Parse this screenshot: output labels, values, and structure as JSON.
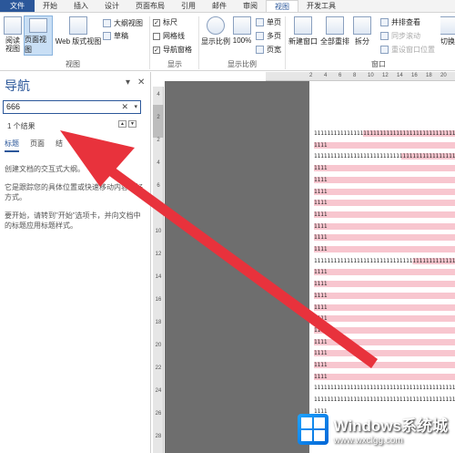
{
  "tabs": [
    "文件",
    "开始",
    "插入",
    "设计",
    "页面布局",
    "引用",
    "邮件",
    "审阅",
    "视图",
    "开发工具"
  ],
  "active_tab": "视图",
  "ribbon": {
    "views_group": {
      "label": "视图",
      "read_mode": "阅读\n视图",
      "print_layout": "页面视图",
      "web_layout": "Web 版式视图",
      "outline": "大纲视图",
      "draft": "草稿"
    },
    "show_group": {
      "label": "显示",
      "ruler": "标尺",
      "gridlines": "网格线",
      "nav_pane": "导航窗格",
      "ruler_checked": true,
      "gridlines_checked": false,
      "nav_pane_checked": true
    },
    "zoom_group": {
      "label": "显示比例",
      "zoom": "显示比例",
      "hundred": "100%",
      "one_page": "单页",
      "multi_page": "多页",
      "page_width": "页宽"
    },
    "window_group": {
      "label": "窗口",
      "new_window": "新建窗口",
      "arrange_all": "全部重排",
      "split": "拆分",
      "side_by_side": "并排查看",
      "sync_scroll": "同步滚动",
      "reset_position": "重设窗口位置",
      "switch": "切换"
    }
  },
  "nav": {
    "title": "导航",
    "search_value": "666",
    "results": "1 个结果",
    "tabs": [
      "标题",
      "页面",
      "结"
    ],
    "body": [
      "创建文档的交互式大纲。",
      "它是跟踪您的具体位置或快速移动内容的好方式。",
      "要开始，请转到\"开始\"选项卡，并向文档中的标题应用标题样式。"
    ]
  },
  "ruler": {
    "v_ticks": [
      "4",
      "2",
      "2",
      "4",
      "6",
      "8",
      "10",
      "12",
      "14",
      "16",
      "18",
      "20",
      "22",
      "24",
      "26",
      "28"
    ],
    "h_ticks": [
      "2",
      "4",
      "6",
      "8",
      "10",
      "12",
      "14",
      "16",
      "18",
      "20"
    ]
  },
  "document": {
    "lines": [
      {
        "text": "1111111111111111111111111111111111111111111111111111111111111",
        "hl": "partial"
      },
      {
        "text": "1111",
        "hl": true
      },
      {
        "text": "11111111111111111111111111111111111111111111111111111111111111",
        "hl": "partial2"
      },
      {
        "text": "1111",
        "hl": true
      },
      {
        "text": "1111",
        "hl": true
      },
      {
        "text": "1111",
        "hl": true
      },
      {
        "text": "1111",
        "hl": true
      },
      {
        "text": "1111",
        "hl": true
      },
      {
        "text": "1111",
        "hl": true
      },
      {
        "text": "1111",
        "hl": true
      },
      {
        "text": "1111",
        "hl": true
      },
      {
        "text": "1111111111111111111111111111111111111111111111111111111111111",
        "hl": "partial3"
      },
      {
        "text": "1111",
        "hl": true
      },
      {
        "text": "1111",
        "hl": true
      },
      {
        "text": "1111",
        "hl": true
      },
      {
        "text": "1111",
        "hl": true
      },
      {
        "text": "1111",
        "hl": true
      },
      {
        "text": "1111",
        "hl": true
      },
      {
        "text": "1111",
        "hl": true
      },
      {
        "text": "1111",
        "hl": true
      },
      {
        "text": "1111",
        "hl": true
      },
      {
        "text": "1111",
        "hl": true
      },
      {
        "text": "1111111111111111111111111111111111111111111111111111111111111",
        "hl": false
      },
      {
        "text": "1111111111111111111111111111111111111111111111111111111111111",
        "hl": false
      },
      {
        "text": "1111",
        "hl": false
      }
    ]
  },
  "watermark": {
    "title": "Windows系统城",
    "url": "www.wxclgg.com"
  },
  "colors": {
    "accent": "#2b579a",
    "highlight": "#f8c6cf",
    "arrow": "#e8323c",
    "doc_bg": "#6e6e6e"
  }
}
